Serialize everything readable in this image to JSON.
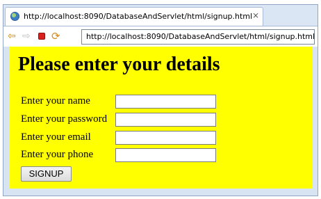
{
  "browser": {
    "tab_title": "http://localhost:8090/DatabaseAndServlet/html/signup.html",
    "tab_close": "⨯",
    "address_url": "http://localhost:8090/DatabaseAndServlet/html/signup.html",
    "icons": {
      "tab": "globe-icon",
      "back": "back-arrow-icon",
      "forward": "forward-arrow-icon",
      "stop": "stop-icon",
      "refresh": "refresh-icon"
    }
  },
  "page": {
    "background_color": "#ffff00",
    "heading": "Please enter your details",
    "fields": [
      {
        "label": "Enter your name",
        "value": ""
      },
      {
        "label": "Enter your password",
        "value": ""
      },
      {
        "label": "Enter your email",
        "value": ""
      },
      {
        "label": "Enter your phone",
        "value": ""
      }
    ],
    "submit_label": "SIGNUP"
  }
}
